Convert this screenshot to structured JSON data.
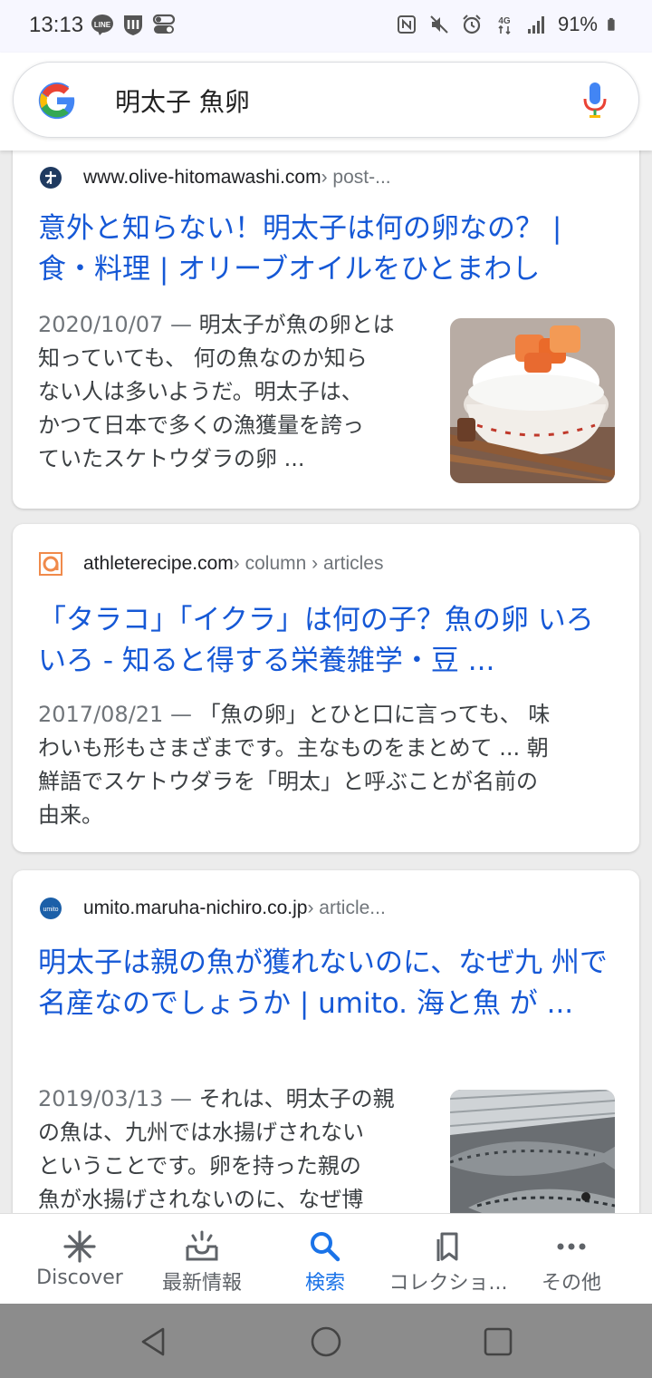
{
  "status_bar": {
    "time": "13:13",
    "battery": "91%"
  },
  "search": {
    "query": "明太子 魚卵"
  },
  "results": [
    {
      "site": "www.olive-hitomawashi.com",
      "path": " › post-...",
      "title": "意外と知らない！明太子は何の卵なの？ | 食・料理 | オリーブオイルをひとまわし",
      "date": "2020/10/07 — ",
      "snippet_lines": [
        "明太子が魚の卵とは",
        "知っていても、 何の魚なのか知ら",
        "ない人は多いようだ。明太子は、",
        "かつて日本で多くの漁獲量を誇っ",
        "ていたスケトウダラの卵 ..."
      ]
    },
    {
      "site": "athleterecipe.com",
      "path": " › column › articles",
      "title": "「タラコ」「イクラ」は何の子？魚の卵 いろいろ - 知ると得する栄養雑学・豆 ...",
      "date": "2017/08/21 — ",
      "snippet_lines": [
        "「魚の卵」とひと口に言っても、 味",
        "わいも形もさまざまです。主なものをまとめて ... 朝",
        "鮮語でスケトウダラを「明太」と呼ぶことが名前の",
        "由来。"
      ]
    },
    {
      "site": "umito.maruha-nichiro.co.jp",
      "path": " › article...",
      "title": "明太子は親の魚が獲れないのに、なぜ九 州で名産なのでしょうか | umito. 海と魚 が ...",
      "date": "2019/03/13 — ",
      "snippet_lines": [
        "それは、明太子の親",
        "の魚は、九州では水揚げされない",
        "ということです。卵を持った親の",
        "魚が水揚げされないのに、なぜ博"
      ]
    }
  ],
  "bottom_nav": [
    {
      "label": "Discover",
      "icon": "asterisk-icon"
    },
    {
      "label": "最新情報",
      "icon": "updates-tray-icon"
    },
    {
      "label": "検索",
      "icon": "search-icon",
      "active": true
    },
    {
      "label": "コレクショ...",
      "icon": "collections-icon"
    },
    {
      "label": "その他",
      "icon": "more-dots-icon"
    }
  ],
  "colors": {
    "link": "#1558d6",
    "active_nav": "#1a73e8"
  }
}
